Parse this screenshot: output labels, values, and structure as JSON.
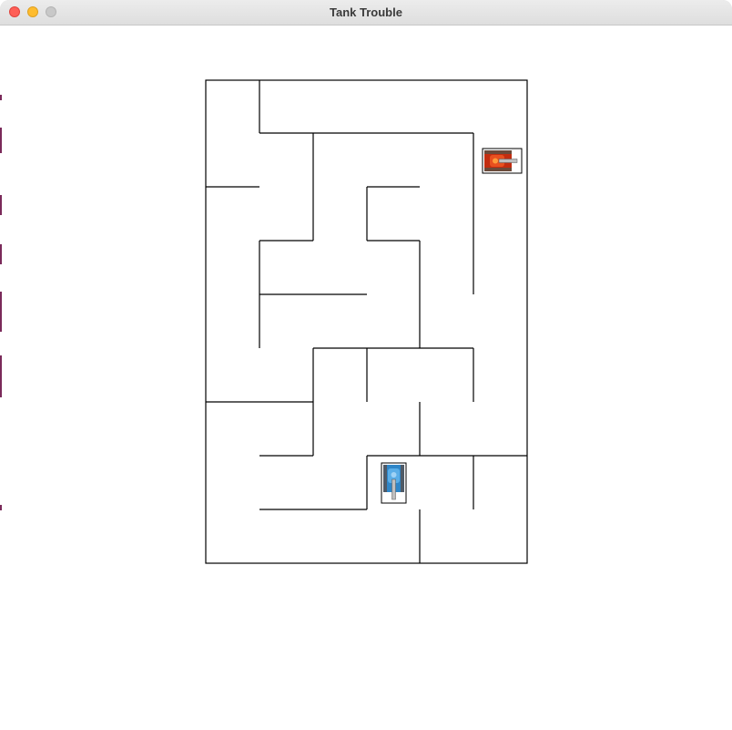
{
  "window": {
    "title": "Tank Trouble"
  },
  "game": {
    "wall_color": "#000000",
    "tanks": [
      {
        "name": "red-tank",
        "color": "#d63a1a",
        "facing": "right"
      },
      {
        "name": "blue-tank",
        "color": "#3a8fd6",
        "facing": "down"
      }
    ]
  }
}
